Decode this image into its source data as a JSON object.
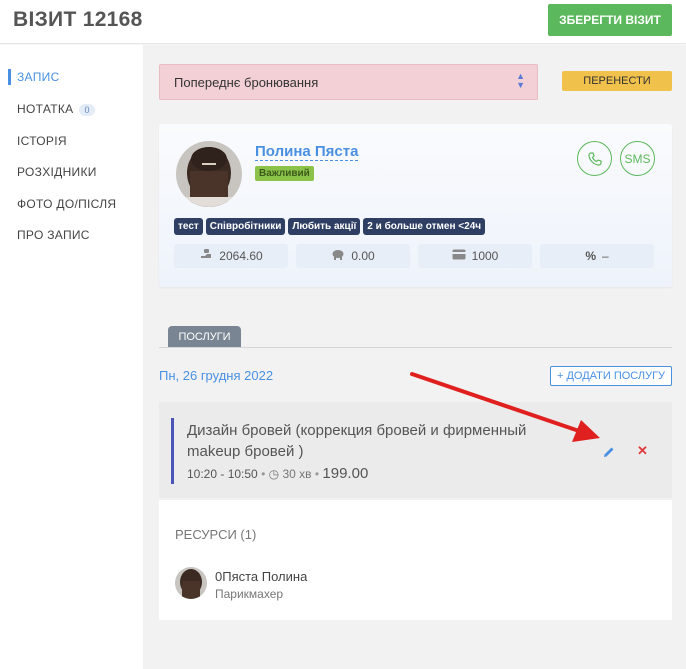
{
  "header": {
    "title": "ВІЗИТ 12168",
    "save_label": "ЗБЕРЕГТИ ВІЗИТ"
  },
  "sidebar": {
    "items": [
      {
        "label": "ЗАПИС",
        "active": true
      },
      {
        "label": "НОТАТКА",
        "count": "0"
      },
      {
        "label": "ІСТОРІЯ"
      },
      {
        "label": "РОЗХІДНИКИ"
      },
      {
        "label": "ФОТО ДО/ПІСЛЯ"
      },
      {
        "label": "ПРО ЗАПИС"
      }
    ]
  },
  "status": {
    "selected": "Попереднє бронювання",
    "reschedule_label": "ПЕРЕНЕСТИ"
  },
  "client": {
    "name": "Полина Пяста",
    "flag": "Важливий",
    "sms_label": "SMS",
    "tags": [
      "тест",
      "Співробітники",
      "Любить акції",
      "2 и больше отмен <24ч"
    ],
    "stats": [
      {
        "icon": "coins-icon",
        "value": "2064.60"
      },
      {
        "icon": "piggy-bank-icon",
        "value": "0.00"
      },
      {
        "icon": "card-icon",
        "value": "1000"
      },
      {
        "icon": "percent-icon",
        "symbol": "%",
        "value": "–"
      }
    ]
  },
  "services": {
    "tab_label": "ПОСЛУГИ",
    "date": "Пн, 26 грудня 2022",
    "add_label": "+ ДОДАТИ ПОСЛУГУ",
    "item": {
      "name": "Дизайн бровей (коррекция бровей и фирменный makeup бровей )",
      "time": "10:20 - 10:50",
      "duration": "30 хв",
      "price": "199.00"
    }
  },
  "resources": {
    "title": "РЕСУРСИ (1)",
    "item": {
      "name": "0Пяста Полина",
      "role": "Парикмахер"
    }
  },
  "colors": {
    "accent": "#4a90e2",
    "save": "#5cb85c",
    "status_bg": "#f2d0d5",
    "reschedule": "#f0c14b",
    "tag_bg": "#2e3f63",
    "service_bar": "#4b54b8",
    "remove": "#e03b3b",
    "arrow": "#e0201f"
  }
}
